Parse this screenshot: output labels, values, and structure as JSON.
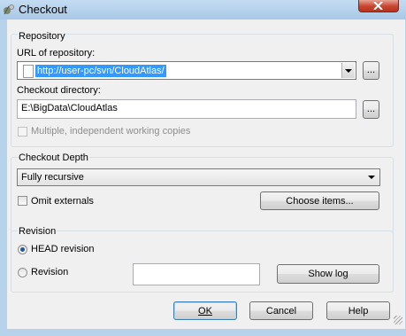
{
  "window": {
    "title": "Checkout"
  },
  "repository": {
    "group_label": "Repository",
    "url_label": "URL of repository:",
    "url_value": "http://user-pc/svn/CloudAtlas/",
    "browse_label": "...",
    "dir_label": "Checkout directory:",
    "dir_value": "E:\\BigData\\CloudAtlas",
    "dir_browse_label": "...",
    "multiple_label": "Multiple, independent working copies"
  },
  "depth": {
    "group_label": "Checkout Depth",
    "selected": "Fully recursive",
    "omit_label": "Omit externals",
    "choose_label": "Choose items..."
  },
  "revision": {
    "group_label": "Revision",
    "head_label": "HEAD revision",
    "revision_label": "Revision",
    "revision_value": "",
    "showlog_label": "Show log"
  },
  "buttons": {
    "ok": "OK",
    "cancel": "Cancel",
    "help": "Help"
  },
  "colors": {
    "selection": "#3399ff",
    "titlebar": "#b7d3ec",
    "close": "#c7452e"
  }
}
